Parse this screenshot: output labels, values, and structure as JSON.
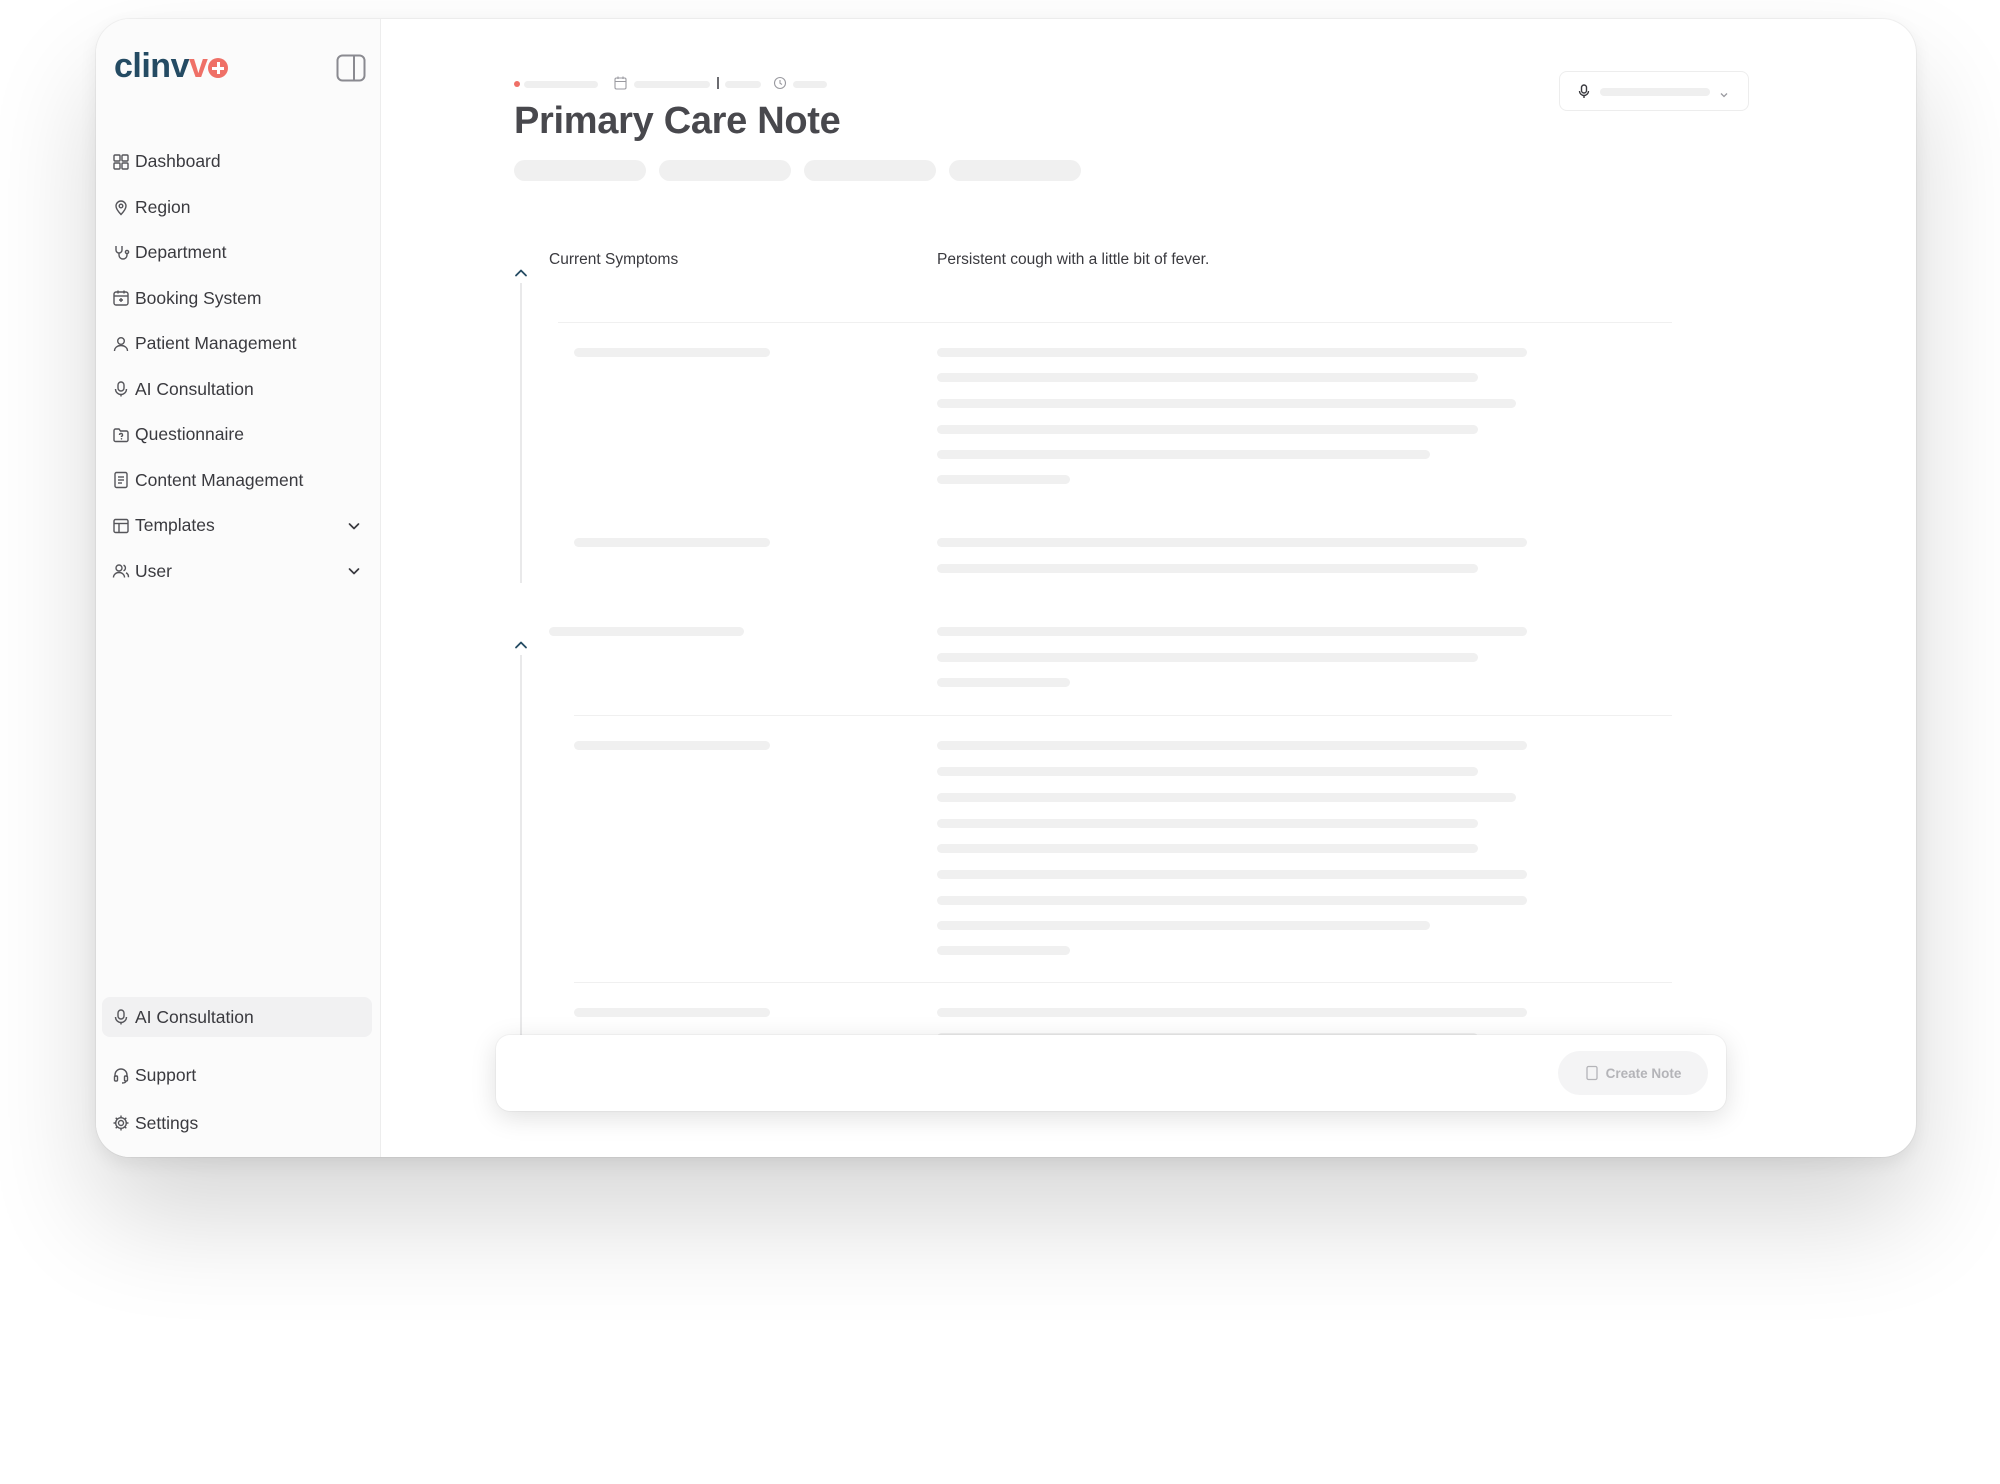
{
  "app": {
    "logo_text_main": "clinv",
    "logo_text_accent": "v"
  },
  "sidebar": {
    "items": [
      {
        "label": "Dashboard",
        "icon": "grid-icon"
      },
      {
        "label": "Region",
        "icon": "map-pin-icon"
      },
      {
        "label": "Department",
        "icon": "stethoscope-icon"
      },
      {
        "label": "Booking System",
        "icon": "calendar-icon"
      },
      {
        "label": "Patient Management",
        "icon": "user-icon"
      },
      {
        "label": "AI Consultation",
        "icon": "microphone-icon"
      },
      {
        "label": "Questionnaire",
        "icon": "folder-question-icon"
      },
      {
        "label": "Content Management",
        "icon": "document-icon"
      },
      {
        "label": "Templates",
        "icon": "table-icon",
        "expandable": true
      },
      {
        "label": "User",
        "icon": "users-icon",
        "expandable": true
      }
    ],
    "bottom_items": [
      {
        "label": "AI Consultation",
        "icon": "microphone-icon",
        "active": true
      },
      {
        "label": "Support",
        "icon": "headset-icon"
      },
      {
        "label": "Settings",
        "icon": "gear-icon"
      }
    ]
  },
  "note": {
    "title": "Primary Care Note",
    "fields": [
      {
        "label": "Current Symptoms",
        "value": "Persistent cough with a little bit of fever."
      }
    ]
  },
  "footer": {
    "create_note_label": "Create Note",
    "create_note_enabled": false
  },
  "colors": {
    "brand_dark": "#244b63",
    "brand_accent": "#ef7067",
    "active_bg": "#f1f1f2"
  }
}
